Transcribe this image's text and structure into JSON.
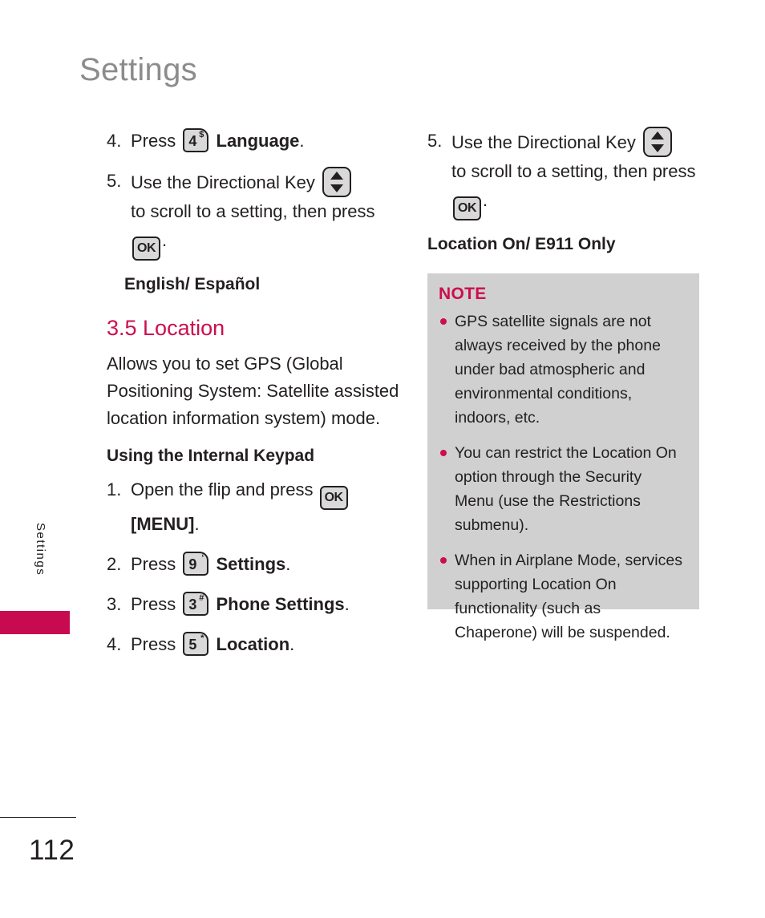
{
  "page": {
    "title": "Settings",
    "side_tab_label": "Settings",
    "page_number": "112",
    "accent_color": "#cc0e51",
    "title_color": "#8c8c8c",
    "note_bg_color": "#d0d0d0"
  },
  "icons": {
    "ok_key": "OK",
    "dir_key": "directional-key",
    "key4_digit": "4",
    "key4_sup": "$",
    "key9_digit": "9",
    "key9_sup": "‘",
    "key3_digit": "3",
    "key3_sup": "#",
    "key5_digit": "5",
    "key5_sup": "*"
  },
  "left_column": {
    "step_4_lang": {
      "num": "4.",
      "text_before": "Press",
      "bold": "Language",
      "text_after": "."
    },
    "step_5_dir": {
      "num": "5.",
      "text_before": "Use the Directional Key",
      "text_middle": "to scroll to a setting, then press",
      "text_after": "."
    },
    "english_espanol": "English/ Español",
    "section_heading": "3.5 Location",
    "description": "Allows you to set GPS (Global Positioning System: Satellite assisted location information system) mode.",
    "using_heading": "Using the Internal Keypad",
    "steps": [
      {
        "num": "1.",
        "text_before": "Open the flip and press",
        "bold": "[MENU]",
        "text_after": ".",
        "key": "ok"
      },
      {
        "num": "2.",
        "text_before": "Press",
        "bold": "Settings",
        "text_after": ".",
        "key": "9"
      },
      {
        "num": "3.",
        "text_before": "Press",
        "bold": "Phone Settings",
        "text_after": ".",
        "key": "3"
      },
      {
        "num": "4.",
        "text_before": "Press",
        "bold": "Location",
        "text_after": ".",
        "key": "5"
      }
    ]
  },
  "right_column": {
    "step_5_dir": {
      "num": "5.",
      "text_before": "Use the Directional Key",
      "text_middle": "to scroll to a setting, then press",
      "text_after": "."
    },
    "location_heading": "Location On/ E911  Only",
    "note": {
      "title": "NOTE",
      "items": [
        "GPS satellite signals are not always received by the phone under bad atmospheric and environmental conditions, indoors, etc.",
        "You can restrict the Location On option through the Security Menu (use the Restrictions submenu).",
        "When in Airplane Mode, services supporting Location On functionality (such as Chaperone) will be suspended."
      ]
    }
  }
}
